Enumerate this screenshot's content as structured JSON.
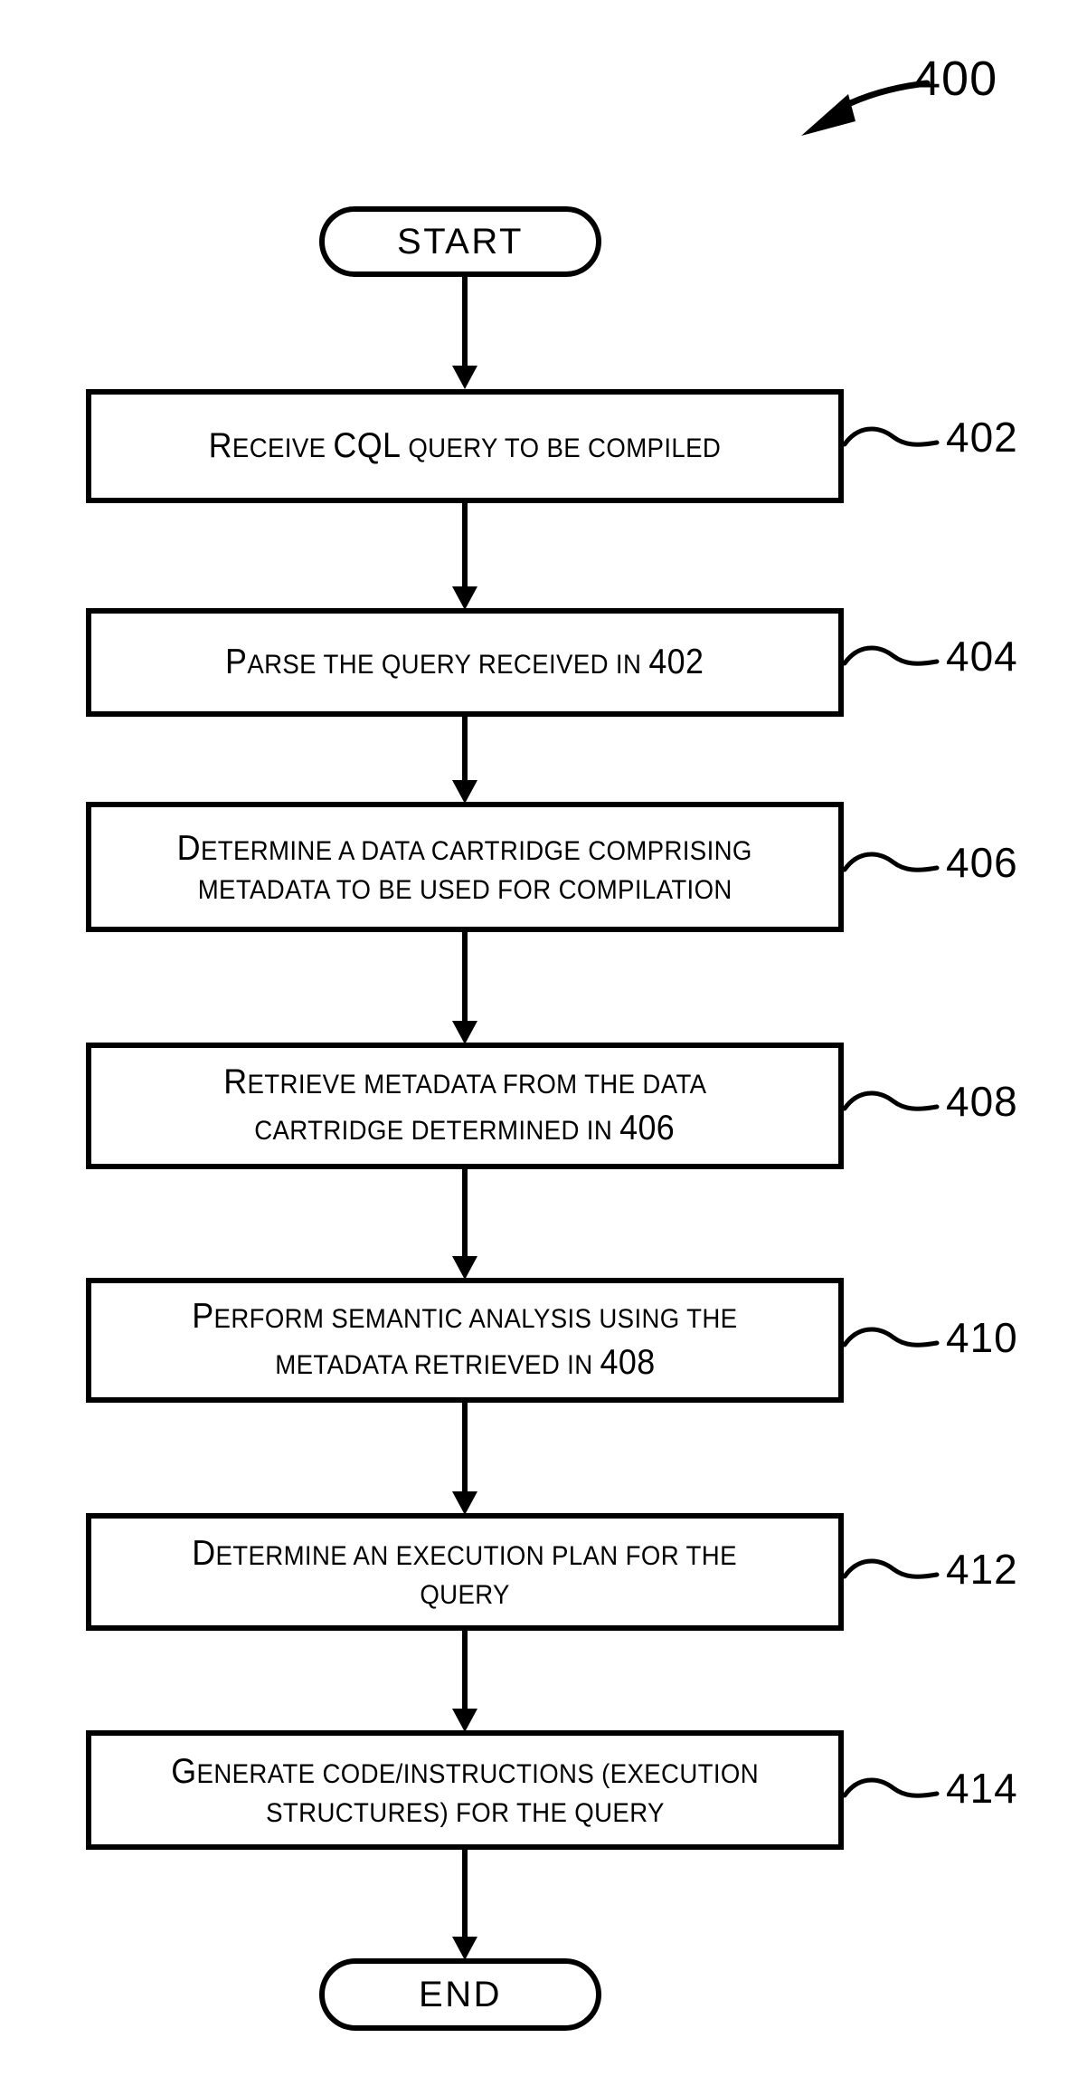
{
  "figure": {
    "number": "400",
    "leader_icon": "curved-arrow-icon"
  },
  "flowchart": {
    "start": {
      "label": "START"
    },
    "end": {
      "label": "END"
    },
    "steps": [
      {
        "ref": "402",
        "lines": [
          [
            {
              "t": "R",
              "cap": true
            },
            {
              "t": "ECEIVE "
            },
            {
              "t": "CQL",
              "cap": true
            },
            {
              "t": " QUERY TO BE COMPILED"
            }
          ]
        ],
        "plain": "RECEIVE CQL QUERY TO BE COMPILED"
      },
      {
        "ref": "404",
        "lines": [
          [
            {
              "t": "P",
              "cap": true
            },
            {
              "t": "ARSE THE QUERY RECEIVED IN "
            },
            {
              "t": "402",
              "num": true
            }
          ]
        ],
        "plain": "PARSE THE QUERY RECEIVED IN 402"
      },
      {
        "ref": "406",
        "lines": [
          [
            {
              "t": "D",
              "cap": true
            },
            {
              "t": "ETERMINE A DATA CARTRIDGE COMPRISING"
            }
          ],
          [
            {
              "t": "METADATA TO BE USED FOR COMPILATION"
            }
          ]
        ],
        "plain": "DETERMINE A DATA CARTRIDGE COMPRISING METADATA TO BE USED FOR COMPILATION"
      },
      {
        "ref": "408",
        "lines": [
          [
            {
              "t": "R",
              "cap": true
            },
            {
              "t": "ETRIEVE METADATA FROM THE DATA"
            }
          ],
          [
            {
              "t": "CARTRIDGE DETERMINED IN "
            },
            {
              "t": "406",
              "num": true
            }
          ]
        ],
        "plain": "RETRIEVE METADATA FROM THE DATA CARTRIDGE DETERMINED IN 406"
      },
      {
        "ref": "410",
        "lines": [
          [
            {
              "t": "P",
              "cap": true
            },
            {
              "t": "ERFORM SEMANTIC ANALYSIS USING THE"
            }
          ],
          [
            {
              "t": "METADATA RETRIEVED IN "
            },
            {
              "t": "408",
              "num": true
            }
          ]
        ],
        "plain": "PERFORM SEMANTIC ANALYSIS USING THE METADATA RETRIEVED IN 408"
      },
      {
        "ref": "412",
        "lines": [
          [
            {
              "t": "D",
              "cap": true
            },
            {
              "t": "ETERMINE AN EXECUTION PLAN FOR THE"
            }
          ],
          [
            {
              "t": "QUERY"
            }
          ]
        ],
        "plain": "DETERMINE AN EXECUTION PLAN FOR THE QUERY"
      },
      {
        "ref": "414",
        "lines": [
          [
            {
              "t": "G",
              "cap": true
            },
            {
              "t": "ENERATE CODE/INSTRUCTIONS (EXECUTION"
            }
          ],
          [
            {
              "t": "STRUCTURES) FOR THE QUERY"
            }
          ]
        ],
        "plain": "GENERATE CODE/INSTRUCTIONS (EXECUTION STRUCTURES) FOR THE QUERY"
      }
    ]
  },
  "style": {
    "stroke_color": "#000000",
    "background_color": "#ffffff"
  }
}
